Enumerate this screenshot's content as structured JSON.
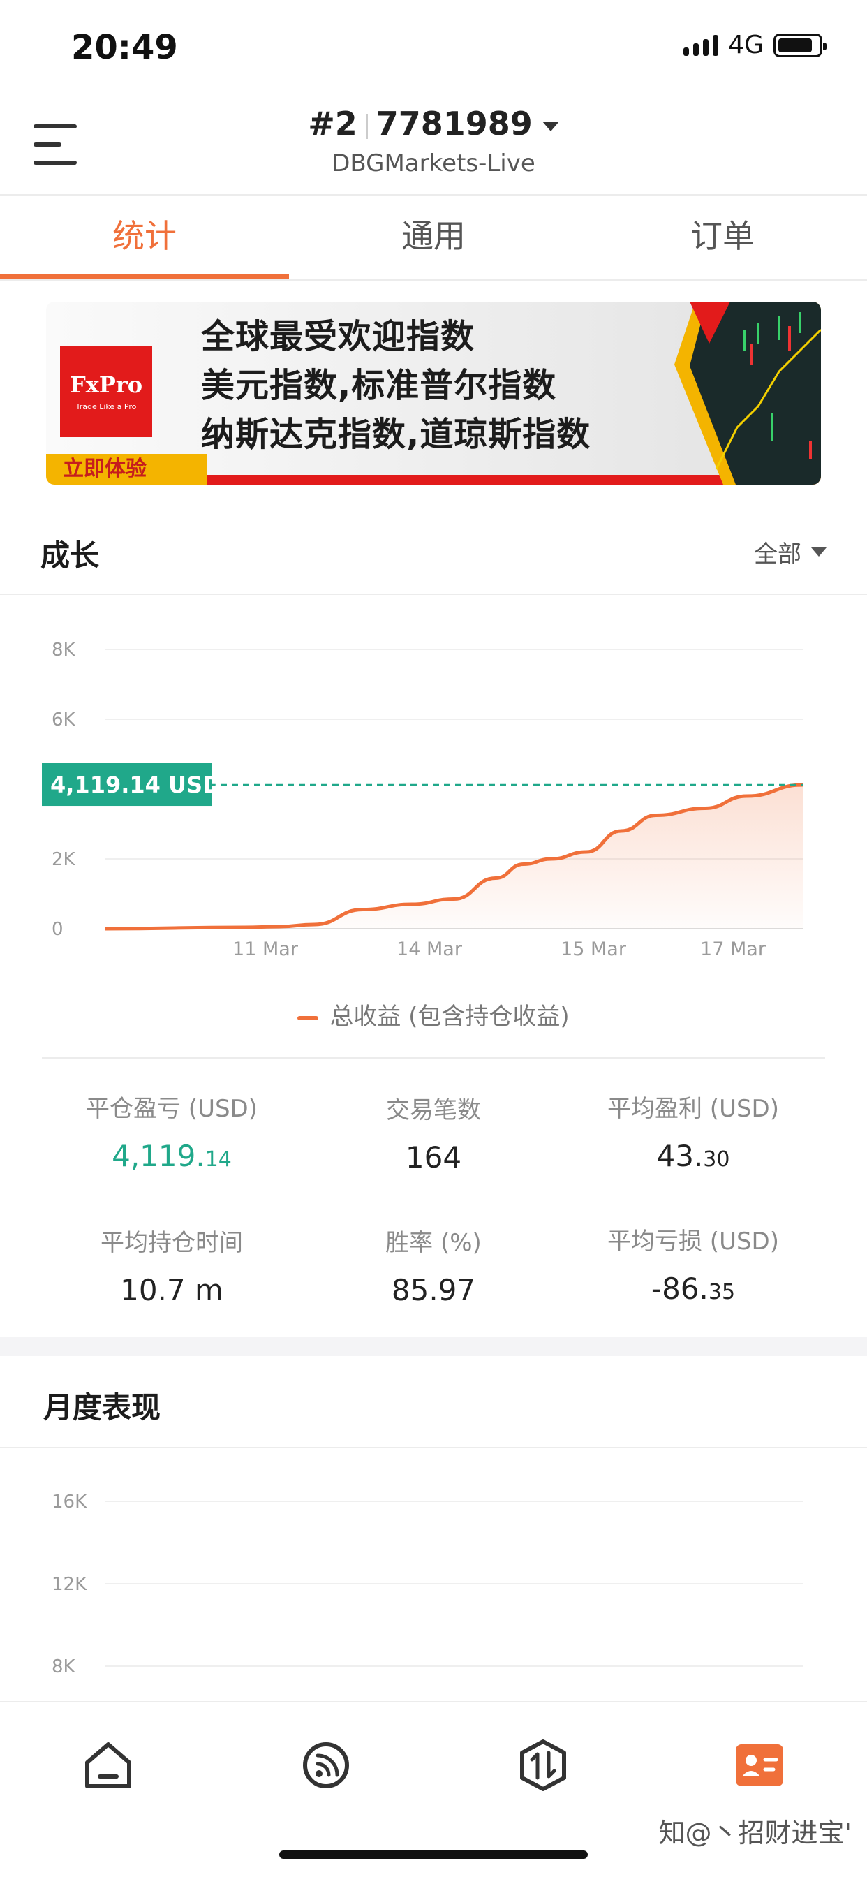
{
  "status": {
    "time": "20:49",
    "network": "4G"
  },
  "header": {
    "account_index": "#2",
    "account_number": "7781989",
    "server": "DBGMarkets-Live"
  },
  "tabs": [
    {
      "label": "统计",
      "active": true
    },
    {
      "label": "通用",
      "active": false
    },
    {
      "label": "订单",
      "active": false
    }
  ],
  "banner": {
    "brand": "FxPro",
    "brand_tagline": "Trade Like a Pro",
    "lines": [
      "全球最受欢迎指数",
      "美元指数,标准普尔指数",
      "纳斯达克指数,道琼斯指数"
    ],
    "cta": "立即体验"
  },
  "growth": {
    "title": "成长",
    "filter": "全部",
    "current_label": "4,119.14 USD",
    "legend": "总收益 (包含持仓收益)"
  },
  "chart_data": {
    "type": "area",
    "y_ticks": [
      "0",
      "2K",
      "6K",
      "8K"
    ],
    "x_ticks": [
      "11 Mar",
      "14 Mar",
      "15 Mar",
      "17 Mar"
    ],
    "ylim": [
      0,
      8000
    ],
    "series": [
      {
        "name": "总收益 (包含持仓收益)",
        "color": "#f0703a",
        "points": [
          [
            0,
            0
          ],
          [
            0.2,
            40
          ],
          [
            0.25,
            60
          ],
          [
            0.3,
            120
          ],
          [
            0.37,
            550
          ],
          [
            0.44,
            700
          ],
          [
            0.5,
            850
          ],
          [
            0.56,
            1450
          ],
          [
            0.6,
            1850
          ],
          [
            0.64,
            2000
          ],
          [
            0.69,
            2200
          ],
          [
            0.74,
            2800
          ],
          [
            0.79,
            3250
          ],
          [
            0.86,
            3450
          ],
          [
            0.92,
            3800
          ],
          [
            1.0,
            4119.14
          ]
        ]
      }
    ],
    "reference_value": 4119.14,
    "grid": true
  },
  "stats": [
    {
      "label": "平仓盈亏 (USD)",
      "int": "4,119.",
      "dec": "14",
      "green": true
    },
    {
      "label": "交易笔数",
      "int": "164",
      "dec": "",
      "green": false
    },
    {
      "label": "平均盈利 (USD)",
      "int": "43.",
      "dec": "30",
      "green": false
    },
    {
      "label": "平均持仓时间",
      "int": "10.7 m",
      "dec": "",
      "green": false
    },
    {
      "label": "胜率 (%)",
      "int": "85.97",
      "dec": "",
      "green": false
    },
    {
      "label": "平均亏损 (USD)",
      "int": "-86.",
      "dec": "35",
      "green": false
    }
  ],
  "monthly": {
    "title": "月度表现",
    "y_ticks": [
      "16K",
      "12K",
      "8K"
    ]
  },
  "bottom_nav": [
    {
      "icon": "home-icon"
    },
    {
      "icon": "signal-feed-icon"
    },
    {
      "icon": "trade-icon"
    },
    {
      "icon": "profile-card-icon",
      "active": true
    }
  ],
  "watermark": "知@丶招财进宝'",
  "colors": {
    "accent": "#f0703a",
    "positive": "#20a88a"
  }
}
